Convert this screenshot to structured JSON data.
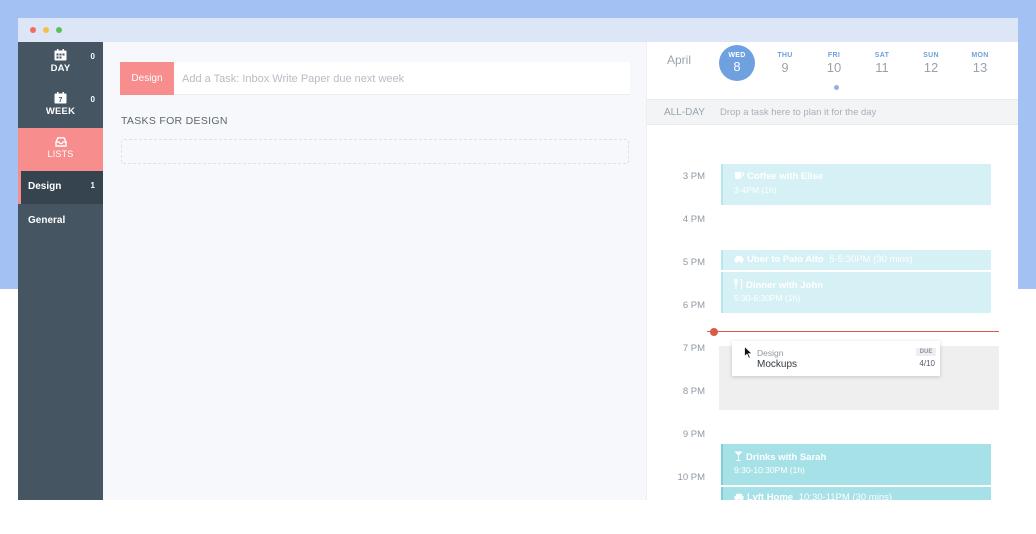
{
  "colors": {
    "background": "#a3c1f3",
    "sidebar": "#455561",
    "accent_pink": "#f78d8d",
    "accent_blue": "#6fa0df",
    "event_light": "#d6f1f5",
    "event_dark": "#a7e1e8",
    "now_line": "#d85b4a"
  },
  "sidebar": {
    "nav": [
      {
        "label": "DAY",
        "count": "0",
        "icon": "calendar-day-icon"
      },
      {
        "label": "WEEK",
        "count": "0",
        "icon": "calendar-week-icon"
      },
      {
        "label": "LISTS",
        "count": "",
        "icon": "inbox-icon"
      }
    ],
    "lists": [
      {
        "label": "Design",
        "count": "1"
      },
      {
        "label": "General",
        "count": ""
      }
    ]
  },
  "tasks": {
    "list_tag": "Design",
    "input_placeholder": "Add a Task: Inbox Write Paper due next week",
    "section_title": "TASKS FOR DESIGN"
  },
  "calendar": {
    "month": "April",
    "days": [
      {
        "name": "WED",
        "num": "8"
      },
      {
        "name": "THU",
        "num": "9"
      },
      {
        "name": "FRI",
        "num": "10"
      },
      {
        "name": "SAT",
        "num": "11"
      },
      {
        "name": "SUN",
        "num": "12"
      },
      {
        "name": "MON",
        "num": "13"
      }
    ],
    "allday_label": "ALL-DAY",
    "allday_hint": "Drop a task here to plan it for the day",
    "hours": [
      "3 PM",
      "4 PM",
      "5 PM",
      "6 PM",
      "7 PM",
      "8 PM",
      "9 PM",
      "10 PM"
    ],
    "events": [
      {
        "title": "Coffee with Elise",
        "time": "3-4PM (1h)",
        "icon": "coffee-icon"
      },
      {
        "title": "Uber to Palo Alto",
        "time": "5-5:30PM (30 mins)",
        "icon": "car-icon"
      },
      {
        "title": "Dinner with John",
        "time": "5:30-6:30PM (1h)",
        "icon": "fork-knife-icon"
      },
      {
        "title": "Drinks with Sarah",
        "time": "9:30-10:30PM (1h)",
        "icon": "cocktail-icon"
      },
      {
        "title": "Lyft Home",
        "time": "10:30-11PM (30 mins)",
        "icon": "car-icon"
      }
    ],
    "task_card": {
      "list": "Design",
      "title": "Mockups",
      "due_badge": "DUE",
      "due_date": "4/10"
    }
  }
}
